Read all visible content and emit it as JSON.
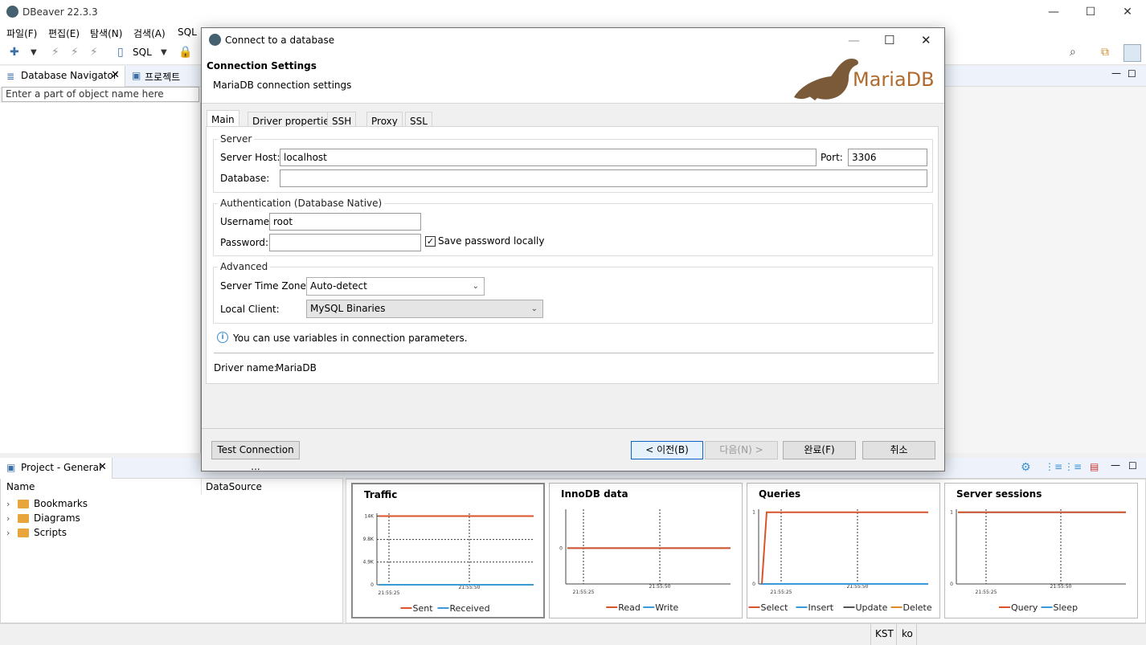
{
  "app": {
    "title": "DBeaver 22.3.3",
    "window_controls": {
      "minimize": "—",
      "maximize": "☐",
      "close": "✕"
    }
  },
  "menubar": [
    "파일(F)",
    "편집(E)",
    "탐색(N)",
    "검색(A)",
    "SQL"
  ],
  "toolbar": {
    "sql_label": "SQL"
  },
  "navigator": {
    "tab_db": "Database Navigator",
    "tab_project": "프로젝트",
    "filter_placeholder": "Enter a part of object name here"
  },
  "project_panel": {
    "tab": "Project - General",
    "col_name": "Name",
    "col_datasource": "DataSource",
    "items": [
      "Bookmarks",
      "Diagrams",
      "Scripts"
    ]
  },
  "dashboard": {
    "charts": [
      {
        "title": "Traffic",
        "yticks": [
          "14K",
          "9.8K",
          "4.9K",
          "0"
        ],
        "xticks": [
          "21:55:25",
          "21:55:50"
        ],
        "legend": [
          "Sent",
          "Received"
        ]
      },
      {
        "title": "InnoDB data",
        "yticks": [
          "0"
        ],
        "xticks": [
          "21:55:25",
          "21:55:50"
        ],
        "legend": [
          "Read",
          "Write"
        ]
      },
      {
        "title": "Queries",
        "yticks": [
          "1",
          "0"
        ],
        "xticks": [
          "21:55:25",
          "21:55:50"
        ],
        "legend": [
          "Select",
          "Insert",
          "Update",
          "Delete"
        ]
      },
      {
        "title": "Server sessions",
        "yticks": [
          "1",
          "0"
        ],
        "xticks": [
          "21:55:25",
          "21:55:50"
        ],
        "legend": [
          "Query",
          "Sleep"
        ]
      }
    ]
  },
  "statusbar": {
    "timezone": "KST",
    "locale": "ko"
  },
  "dialog": {
    "title": "Connect to a database",
    "header_title": "Connection Settings",
    "header_subtitle": "MariaDB connection settings",
    "logo_text": "MariaDB",
    "tabs": [
      "Main",
      "Driver properties",
      "SSH",
      "Proxy",
      "SSL"
    ],
    "server": {
      "legend": "Server",
      "host_label": "Server Host:",
      "host_value": "localhost",
      "port_label": "Port:",
      "port_value": "3306",
      "database_label": "Database:",
      "database_value": ""
    },
    "auth": {
      "legend": "Authentication (Database Native)",
      "username_label": "Username:",
      "username_value": "root",
      "password_label": "Password:",
      "password_value": "",
      "save_password_label": "Save password locally",
      "save_password_checked": true
    },
    "advanced": {
      "legend": "Advanced",
      "timezone_label": "Server Time Zone:",
      "timezone_value": "Auto-detect",
      "client_label": "Local Client:",
      "client_value": "MySQL Binaries"
    },
    "info_text": "You can use variables in connection parameters.",
    "driver_name_label": "Driver name:",
    "driver_name_value": "MariaDB",
    "buttons": {
      "test": "Test Connection ...",
      "back": "< 이전(B)",
      "next": "다음(N) >",
      "finish": "완료(F)",
      "cancel": "취소"
    }
  },
  "colors": {
    "series_primary": "#d9542b",
    "series_secondary": "#3a9ad9",
    "accent": "#3b6fa8"
  }
}
